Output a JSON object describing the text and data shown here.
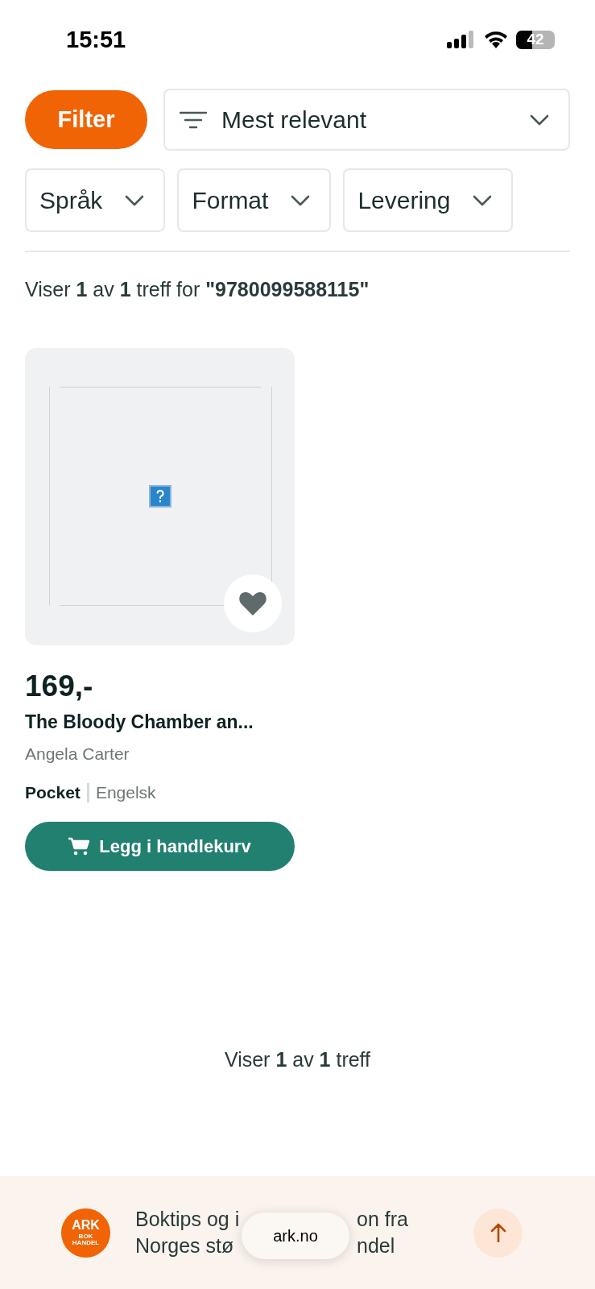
{
  "status_bar": {
    "time": "15:51",
    "battery": "42"
  },
  "filter_button": {
    "label": "Filter"
  },
  "sort": {
    "label": "Mest relevant"
  },
  "filters": [
    {
      "label": "Språk"
    },
    {
      "label": "Format"
    },
    {
      "label": "Levering"
    }
  ],
  "result_summary": "Viser **1** av **1** treff for **\"9780099588115\"**",
  "products": [
    {
      "price": "169,-",
      "title": "The Bloody Chamber an...",
      "author": "Angela Carter",
      "format": "Pocket",
      "language": "Engelsk",
      "cart_button": "Legg i handlekurv"
    }
  ],
  "footer_summary": "Viser **1** av **1** treff",
  "banner": {
    "logo": {
      "top": "ARK",
      "left": "BOK",
      "bottom": "HANDEL"
    },
    "lines": [
      {
        "before": "Boktips og i",
        "after": "on fra"
      },
      {
        "before": "Norges stø",
        "after": "ndel"
      }
    ],
    "address_pill": "ark.no"
  }
}
